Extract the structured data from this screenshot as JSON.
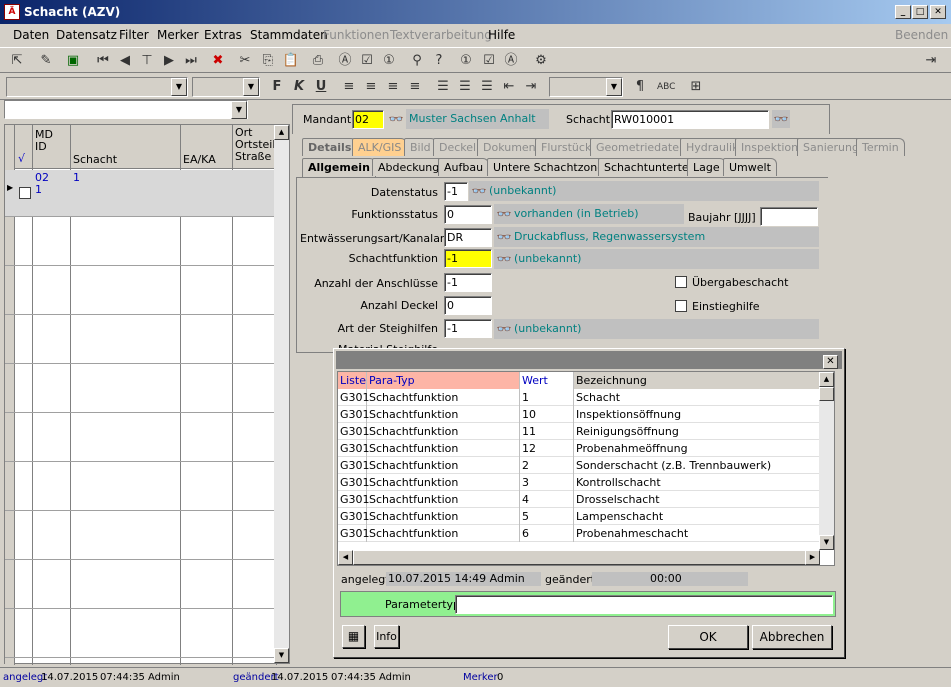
{
  "window": {
    "title": "Schacht (AZV)"
  },
  "menu": {
    "items": [
      "Daten",
      "Datensatz",
      "Filter",
      "Merker",
      "Extras",
      "Stammdaten",
      "Funktionen",
      "Textverarbeitung",
      "Hilfe"
    ],
    "beenden": "Beenden"
  },
  "format": {
    "bold": "F",
    "italic": "K",
    "underline": "U",
    "pilcrow": "¶"
  },
  "grid": {
    "headers": {
      "check": "√",
      "md_id": "MD\nID",
      "schacht": "Schacht",
      "ea_ka": "EA/KA",
      "ort": "Ort\nOrtsteil\nStraße"
    },
    "row1": {
      "md": "02",
      "id": "1",
      "schacht": "1"
    }
  },
  "header": {
    "mandant_label": "Mandant",
    "mandant_value": "02",
    "mandant_name": "Muster Sachsen Anhalt",
    "schacht_label": "Schacht",
    "schacht_value": "RW010001"
  },
  "tabs1": [
    "Details",
    "ALK/GIS",
    "Bild",
    "Deckel",
    "Dokument",
    "Flurstück",
    "Geometriedaten",
    "Hydraulik",
    "Inspektion",
    "Sanierung",
    "Termin"
  ],
  "tabs2": [
    "Allgemein",
    "Abdeckung",
    "Aufbau",
    "Untere Schachtzone",
    "Schachtunterteil",
    "Lage",
    "Umwelt"
  ],
  "form": {
    "datenstatus": {
      "label": "Datenstatus",
      "value": "-1",
      "text": "(unbekannt)"
    },
    "funktionsstatus": {
      "label": "Funktionsstatus",
      "value": "0",
      "text": "vorhanden (in Betrieb)"
    },
    "baujahr_label": "Baujahr [JJJJ]",
    "entwaesserung": {
      "label": "Entwässerungsart/Kanalart",
      "value": "DR",
      "text": "Druckabfluss, Regenwassersystem"
    },
    "schachtfunktion": {
      "label": "Schachtfunktion",
      "value": "-1",
      "text": "(unbekannt)"
    },
    "anschluesse": {
      "label": "Anzahl der Anschlüsse",
      "value": "-1"
    },
    "deckel": {
      "label": "Anzahl Deckel",
      "value": "0"
    },
    "steighilfen": {
      "label": "Art der Steighilfen",
      "value": "-1",
      "text": "(unbekannt)"
    },
    "uebergabe": "Übergabeschacht",
    "einstieg": "Einstieghilfe",
    "material_partial": "Material Steighilfe"
  },
  "dialog": {
    "columns": [
      "Liste",
      "Para-Typ",
      "Wert",
      "Bezeichnung"
    ],
    "rows": [
      [
        "G301",
        "Schachtfunktion",
        "1",
        "Schacht"
      ],
      [
        "G301",
        "Schachtfunktion",
        "10",
        "Inspektionsöffnung"
      ],
      [
        "G301",
        "Schachtfunktion",
        "11",
        "Reinigungsöffnung"
      ],
      [
        "G301",
        "Schachtfunktion",
        "12",
        "Probenahmeöffnung"
      ],
      [
        "G301",
        "Schachtfunktion",
        "2",
        "Sonderschacht (z.B. Trennbauwerk)"
      ],
      [
        "G301",
        "Schachtfunktion",
        "3",
        "Kontrollschacht"
      ],
      [
        "G301",
        "Schachtfunktion",
        "4",
        "Drosselschacht"
      ],
      [
        "G301",
        "Schachtfunktion",
        "5",
        "Lampenschacht"
      ],
      [
        "G301",
        "Schachtfunktion",
        "6",
        "Probenahmeschacht"
      ]
    ],
    "angelegt_label": "angelegt",
    "angelegt_value": "10.07.2015 14:49 Admin",
    "geaendert_label": "geändert",
    "geaendert_value": "00:00",
    "parametertyp_label": "Parametertyp:",
    "info": "Info",
    "ok": "OK",
    "abbrechen": "Abbrechen"
  },
  "status": {
    "angelegt": "angelegt",
    "date1": "14.07.2015",
    "time1": "07:44:35",
    "user1": "Admin",
    "geaendert": "geändert",
    "date2": "14.07.2015",
    "time2": "07:44:35",
    "user2": "Admin",
    "merker": "Merker",
    "merker_val": "0"
  }
}
